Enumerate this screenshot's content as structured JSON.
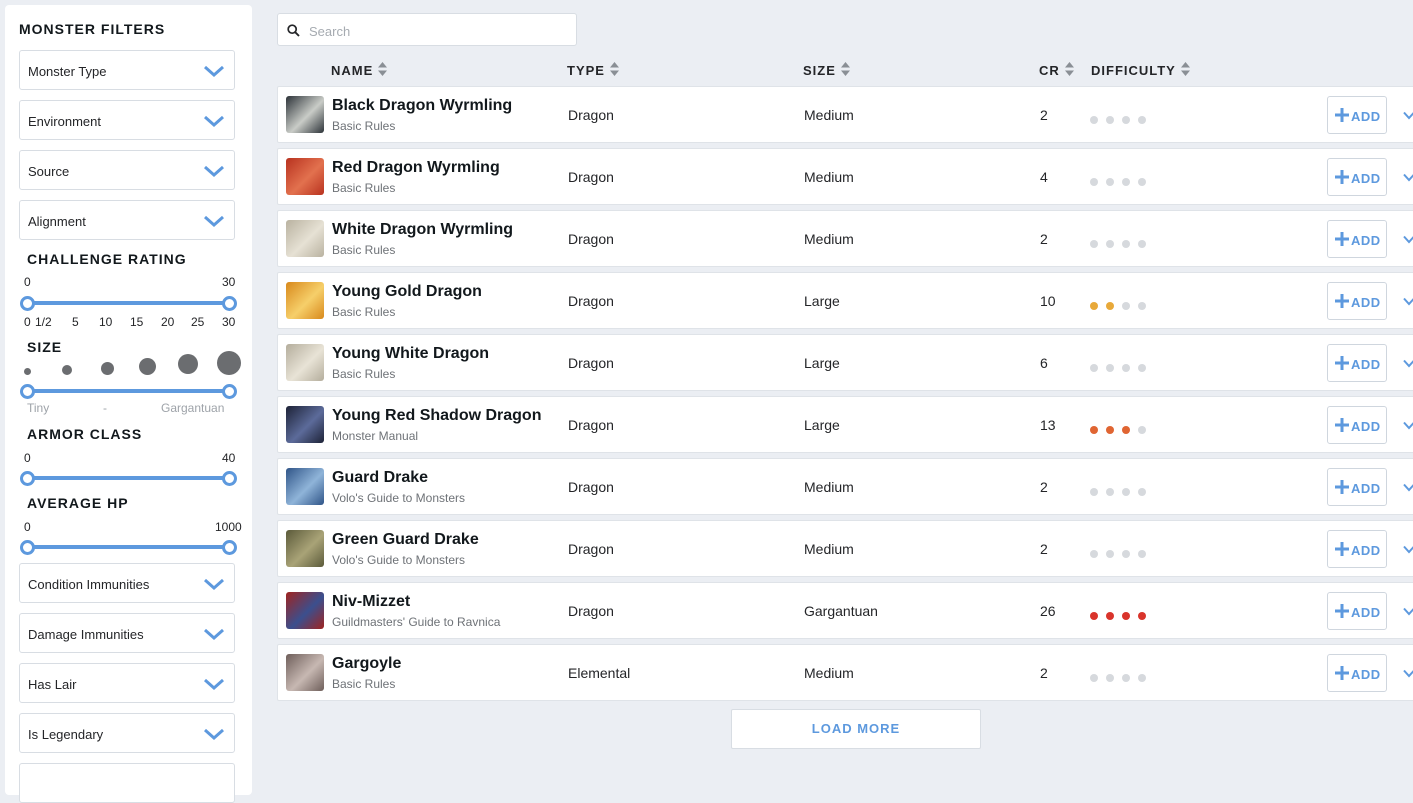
{
  "sidebar": {
    "title": "MONSTER FILTERS",
    "dropdowns_top": [
      "Monster Type",
      "Environment",
      "Source",
      "Alignment"
    ],
    "challenge_rating": {
      "title": "CHALLENGE RATING",
      "min": "0",
      "max": "30",
      "ticks": [
        "0",
        "1/2",
        "5",
        "10",
        "15",
        "20",
        "25",
        "30"
      ]
    },
    "size": {
      "title": "SIZE",
      "min_label": "Tiny",
      "mid_label": "-",
      "max_label": "Gargantuan"
    },
    "armor_class": {
      "title": "ARMOR CLASS",
      "min": "0",
      "max": "40"
    },
    "average_hp": {
      "title": "AVERAGE HP",
      "min": "0",
      "max": "1000"
    },
    "dropdowns_bottom": [
      "Condition Immunities",
      "Damage Immunities",
      "Has Lair",
      "Is Legendary"
    ]
  },
  "search": {
    "placeholder": "Search",
    "value": ""
  },
  "columns": {
    "name": "NAME",
    "type": "TYPE",
    "size": "SIZE",
    "cr": "CR",
    "difficulty": "DIFFICULTY"
  },
  "add_label": "ADD",
  "load_more": "LOAD MORE",
  "colors": {
    "accent": "#5d99de",
    "difficulty_empty": "#d6d9dd",
    "difficulty_medium": "#e8a93a",
    "difficulty_hard": "#e06532",
    "difficulty_deadly": "#d9342b"
  },
  "monsters": [
    {
      "name": "Black Dragon Wyrmling",
      "source": "Basic Rules",
      "type": "Dragon",
      "size": "Medium",
      "cr": "2",
      "difficulty": 0,
      "difficulty_level": "none",
      "thumb": [
        "#2c3238",
        "#c9ccc7"
      ]
    },
    {
      "name": "Red Dragon Wyrmling",
      "source": "Basic Rules",
      "type": "Dragon",
      "size": "Medium",
      "cr": "4",
      "difficulty": 0,
      "difficulty_level": "none",
      "thumb": [
        "#b8321f",
        "#e2714e"
      ]
    },
    {
      "name": "White Dragon Wyrmling",
      "source": "Basic Rules",
      "type": "Dragon",
      "size": "Medium",
      "cr": "2",
      "difficulty": 0,
      "difficulty_level": "none",
      "thumb": [
        "#b9b2a0",
        "#e6e1d4"
      ]
    },
    {
      "name": "Young Gold Dragon",
      "source": "Basic Rules",
      "type": "Dragon",
      "size": "Large",
      "cr": "10",
      "difficulty": 2,
      "difficulty_level": "medium",
      "thumb": [
        "#d8891c",
        "#f6cf6a"
      ]
    },
    {
      "name": "Young White Dragon",
      "source": "Basic Rules",
      "type": "Dragon",
      "size": "Large",
      "cr": "6",
      "difficulty": 0,
      "difficulty_level": "none",
      "thumb": [
        "#b4ad9c",
        "#e8e3d6"
      ]
    },
    {
      "name": "Young Red Shadow Dragon",
      "source": "Monster Manual",
      "type": "Dragon",
      "size": "Large",
      "cr": "13",
      "difficulty": 3,
      "difficulty_level": "hard",
      "thumb": [
        "#1d2236",
        "#5c6b9a"
      ]
    },
    {
      "name": "Guard Drake",
      "source": "Volo's Guide to Monsters",
      "type": "Dragon",
      "size": "Medium",
      "cr": "2",
      "difficulty": 0,
      "difficulty_level": "none",
      "thumb": [
        "#2f5487",
        "#8fb4d9"
      ]
    },
    {
      "name": "Green Guard Drake",
      "source": "Volo's Guide to Monsters",
      "type": "Dragon",
      "size": "Medium",
      "cr": "2",
      "difficulty": 0,
      "difficulty_level": "none",
      "thumb": [
        "#5b5a3a",
        "#a9a377"
      ]
    },
    {
      "name": "Niv-Mizzet",
      "source": "Guildmasters' Guide to Ravnica",
      "type": "Dragon",
      "size": "Gargantuan",
      "cr": "26",
      "difficulty": 4,
      "difficulty_level": "deadly",
      "thumb": [
        "#a0231f",
        "#3b4f8e"
      ]
    },
    {
      "name": "Gargoyle",
      "source": "Basic Rules",
      "type": "Elemental",
      "size": "Medium",
      "cr": "2",
      "difficulty": 0,
      "difficulty_level": "none",
      "thumb": [
        "#6e5e5a",
        "#c7b8b2"
      ]
    }
  ]
}
